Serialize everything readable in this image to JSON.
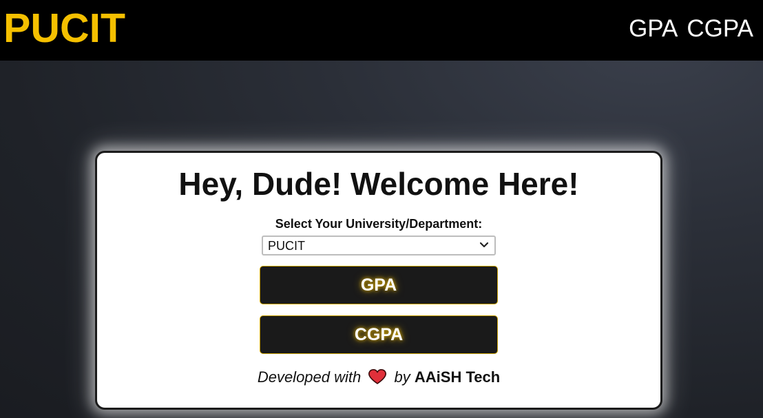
{
  "header": {
    "brand": "PUCIT",
    "nav": [
      {
        "label": "GPA"
      },
      {
        "label": "CGPA"
      }
    ]
  },
  "card": {
    "heading": "Hey, Dude! Welcome Here!",
    "select_label": "Select Your University/Department:",
    "select_value": "PUCIT",
    "buttons": {
      "gpa": "GPA",
      "cgpa": "CGPA"
    },
    "footer": {
      "prefix": "Developed with",
      "icon": "heart-icon",
      "by": "by",
      "company": "AAiSH Tech"
    }
  },
  "colors": {
    "brand": "#f5c000",
    "header_bg": "#000000",
    "button_bg": "#1a1a1a",
    "heart": "#e0303a"
  }
}
